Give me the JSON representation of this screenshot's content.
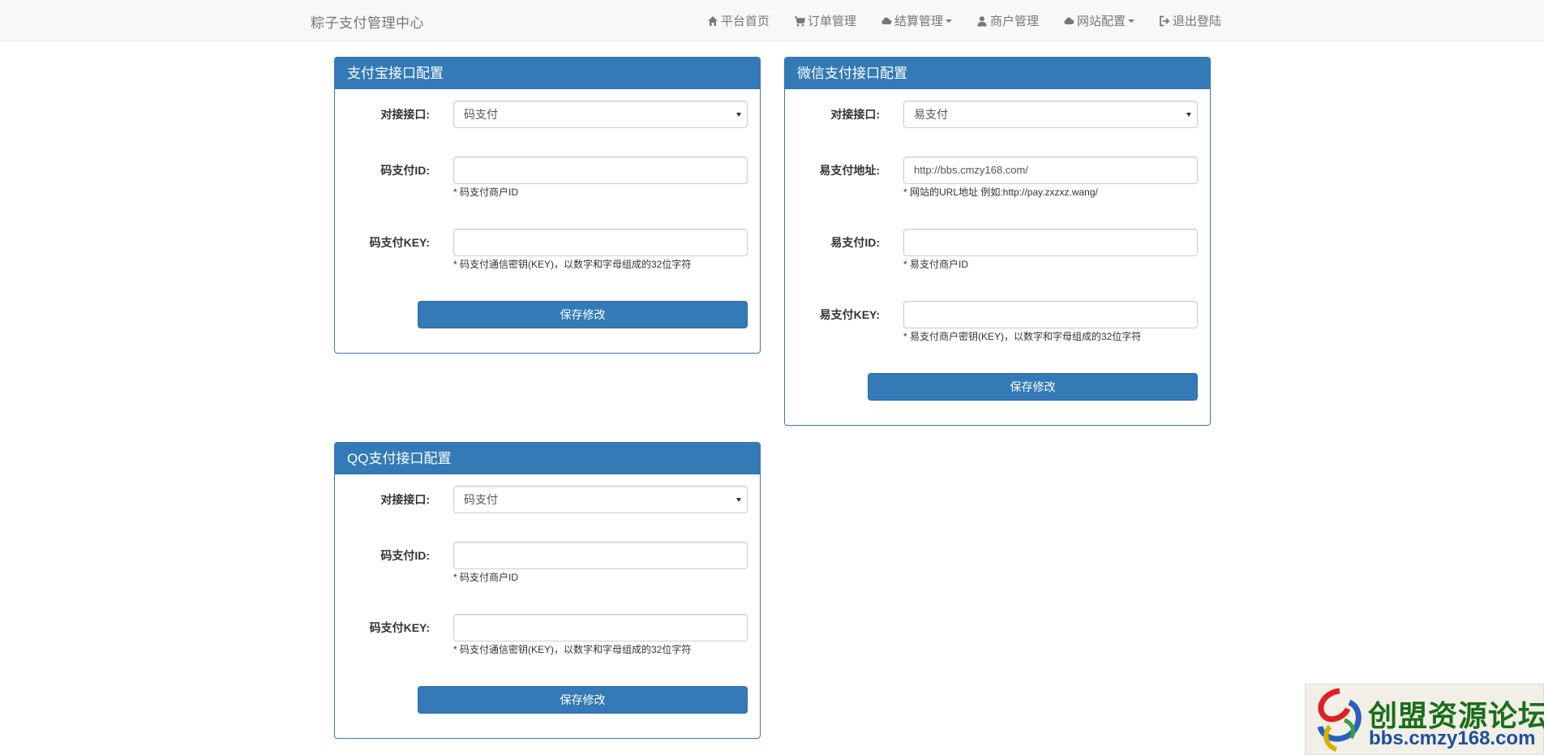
{
  "brand": "粽子支付管理中心",
  "nav": {
    "home": "平台首页",
    "orders": "订单管理",
    "settlement": "结算管理",
    "merchants": "商户管理",
    "site_config": "网站配置",
    "logout": "退出登陆"
  },
  "icons": {
    "home": "home-icon",
    "orders": "cart-icon",
    "settlement": "cloud-icon",
    "merchants": "user-icon",
    "site_config": "cloud-icon",
    "logout": "logout-icon"
  },
  "alipay": {
    "title": "支付宝接口配置",
    "interface_label": "对接接口:",
    "interface_value": "码支付",
    "id_label": "码支付ID:",
    "id_value": "",
    "id_help": "* 码支付商户ID",
    "key_label": "码支付KEY:",
    "key_value": "",
    "key_help": "* 码支付通信密钥(KEY)，以数字和字母组成的32位字符",
    "save": "保存修改"
  },
  "wechat": {
    "title": "微信支付接口配置",
    "interface_label": "对接接口:",
    "interface_value": "易支付",
    "url_label": "易支付地址:",
    "url_value": "http://bbs.cmzy168.com/",
    "url_help": "* 网站的URL地址 例如:http://pay.zxzxz.wang/",
    "id_label": "易支付ID:",
    "id_value": "",
    "id_help": "* 易支付商户ID",
    "key_label": "易支付KEY:",
    "key_value": "",
    "key_help": "* 易支付商户密钥(KEY)，以数字和字母组成的32位字符",
    "save": "保存修改"
  },
  "qq": {
    "title": "QQ支付接口配置",
    "interface_label": "对接接口:",
    "interface_value": "码支付",
    "id_label": "码支付ID:",
    "id_value": "",
    "id_help": "* 码支付商户ID",
    "key_label": "码支付KEY:",
    "key_value": "",
    "key_help": "* 码支付通信密钥(KEY)，以数字和字母组成的32位字符",
    "save": "保存修改"
  },
  "watermark": {
    "title": "创盟资源论坛",
    "url": "bbs.cmzy168.com"
  },
  "colors": {
    "primary": "#337ab7",
    "navbar_bg": "#f8f8f8"
  }
}
